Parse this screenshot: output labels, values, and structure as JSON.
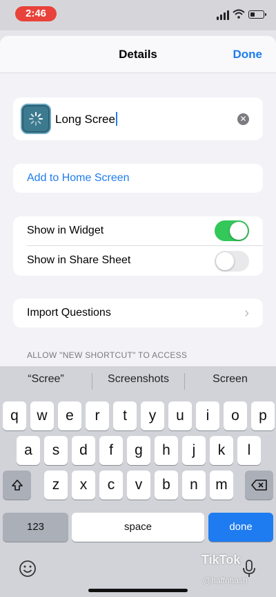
{
  "status_bar": {
    "time": "2:46"
  },
  "navbar": {
    "title": "Details",
    "done_label": "Done"
  },
  "shortcut": {
    "name_value": "Long Scree",
    "icon": "loading-spinner-icon"
  },
  "home_screen": {
    "label": "Add to Home Screen"
  },
  "toggles": {
    "widget_label": "Show in Widget",
    "widget_on": true,
    "share_label": "Show in Share Sheet",
    "share_on": false
  },
  "import": {
    "label": "Import Questions"
  },
  "section_header": "ALLOW \"NEW SHORTCUT\" TO ACCESS",
  "keyboard": {
    "suggestions": [
      "“Scree”",
      "Screenshots",
      "Screen"
    ],
    "row1": [
      "q",
      "w",
      "e",
      "r",
      "t",
      "y",
      "u",
      "i",
      "o",
      "p"
    ],
    "row2": [
      "a",
      "s",
      "d",
      "f",
      "g",
      "h",
      "j",
      "k",
      "l"
    ],
    "row3": [
      "z",
      "x",
      "c",
      "v",
      "b",
      "n",
      "m"
    ],
    "shift_icon": "shift-icon",
    "delete_icon": "backspace-icon",
    "numbers_label": "123",
    "space_label": "space",
    "done_label": "done"
  },
  "watermark": {
    "brand": "TikTok",
    "handle": "@haffnhash"
  },
  "colors": {
    "accent": "#1e7cf0",
    "toggle_on": "#34c759",
    "status_pill": "#e8423a"
  }
}
